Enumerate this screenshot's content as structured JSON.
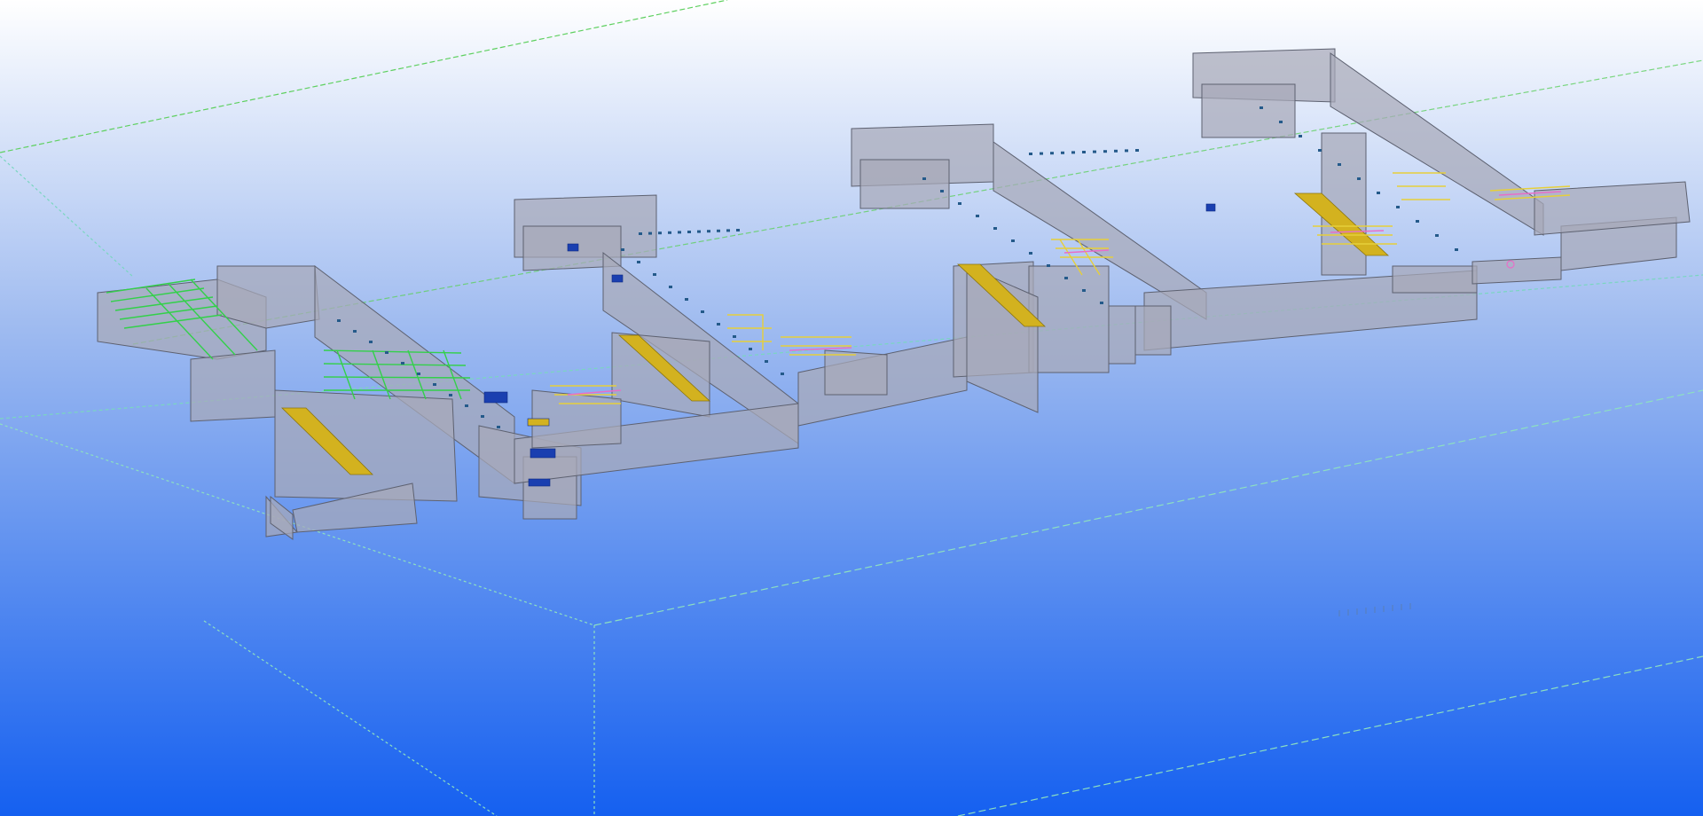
{
  "viewport": {
    "background_top": "#ffffff",
    "background_mid": "#9fbbf0",
    "background_bottom": "#1560f0",
    "grid_color": "#5fd060",
    "grid_line_color_alt": "#8de0c0"
  },
  "model": {
    "volume_fill": "#a7a9b8",
    "volume_stroke": "#5d6170",
    "steel_green": "#33d04a",
    "steel_yellow": "#e6cf3a",
    "pipe_pink": "#e86ec8",
    "equipment_blue": "#1a3fb0",
    "equipment_cyan": "#20b4e6",
    "slab_yellow": "#d3b21f"
  },
  "icons": {
    "origin_marker": "circle-marker-icon"
  }
}
